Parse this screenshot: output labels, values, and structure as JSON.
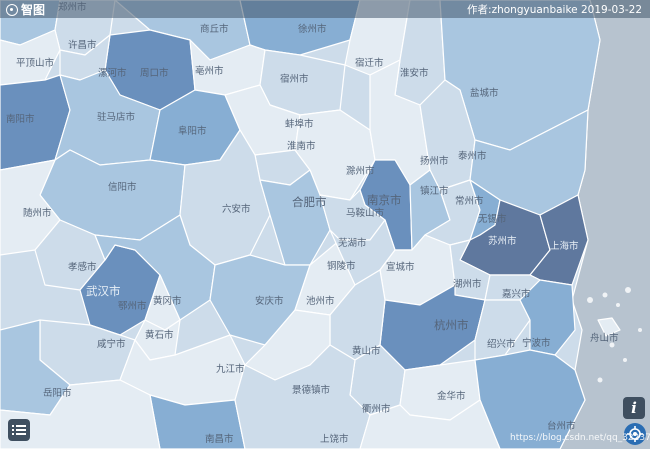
{
  "header": {
    "logo_text": "智图",
    "author_credit": "作者:zhongyuanbaike 2019-03-22"
  },
  "map": {
    "region_colors": {
      "pale": "#e4ecf3",
      "light": "#cddcea",
      "mid": "#a9c6e0",
      "strong": "#87aed3",
      "deep": "#6a90bd",
      "darkest": "#5f789e",
      "sea": "#b7c3cf"
    },
    "cities": [
      {
        "name": "郑州市",
        "style": "normal"
      },
      {
        "name": "许昌市",
        "style": "normal"
      },
      {
        "name": "商丘市",
        "style": "normal"
      },
      {
        "name": "徐州市",
        "style": "normal"
      },
      {
        "name": "平顶山市",
        "style": "normal"
      },
      {
        "name": "周口市",
        "style": "normal"
      },
      {
        "name": "漯河市",
        "style": "normal"
      },
      {
        "name": "亳州市",
        "style": "normal"
      },
      {
        "name": "宿州市",
        "style": "normal"
      },
      {
        "name": "宿迁市",
        "style": "normal"
      },
      {
        "name": "淮安市",
        "style": "normal"
      },
      {
        "name": "盐城市",
        "style": "normal"
      },
      {
        "name": "南阳市",
        "style": "normal"
      },
      {
        "name": "驻马店市",
        "style": "normal"
      },
      {
        "name": "阜阳市",
        "style": "normal"
      },
      {
        "name": "蚌埠市",
        "style": "normal"
      },
      {
        "name": "淮南市",
        "style": "normal"
      },
      {
        "name": "滁州市",
        "style": "normal"
      },
      {
        "name": "扬州市",
        "style": "normal"
      },
      {
        "name": "泰州市",
        "style": "normal"
      },
      {
        "name": "南京市",
        "style": "big"
      },
      {
        "name": "信阳市",
        "style": "normal"
      },
      {
        "name": "随州市",
        "style": "normal"
      },
      {
        "name": "六安市",
        "style": "normal"
      },
      {
        "name": "合肥市",
        "style": "big"
      },
      {
        "name": "马鞍山市",
        "style": "normal"
      },
      {
        "name": "镇江市",
        "style": "normal"
      },
      {
        "name": "常州市",
        "style": "normal"
      },
      {
        "name": "无锡市",
        "style": "normal"
      },
      {
        "name": "苏州市",
        "style": "dark"
      },
      {
        "name": "上海市",
        "style": "dark"
      },
      {
        "name": "芜湖市",
        "style": "normal"
      },
      {
        "name": "铜陵市",
        "style": "normal"
      },
      {
        "name": "宣城市",
        "style": "normal"
      },
      {
        "name": "湖州市",
        "style": "normal"
      },
      {
        "name": "嘉兴市",
        "style": "normal"
      },
      {
        "name": "孝感市",
        "style": "normal"
      },
      {
        "name": "武汉市",
        "style": "bigdark"
      },
      {
        "name": "黄冈市",
        "style": "normal"
      },
      {
        "name": "鄂州市",
        "style": "normal"
      },
      {
        "name": "黄石市",
        "style": "normal"
      },
      {
        "name": "安庆市",
        "style": "normal"
      },
      {
        "name": "池州市",
        "style": "normal"
      },
      {
        "name": "杭州市",
        "style": "big"
      },
      {
        "name": "绍兴市",
        "style": "normal"
      },
      {
        "name": "宁波市",
        "style": "normal"
      },
      {
        "name": "咸宁市",
        "style": "normal"
      },
      {
        "name": "黄山市",
        "style": "normal"
      },
      {
        "name": "舟山市",
        "style": "normal"
      },
      {
        "name": "岳阳市",
        "style": "normal"
      },
      {
        "name": "九江市",
        "style": "normal"
      },
      {
        "name": "景德镇市",
        "style": "normal"
      },
      {
        "name": "衢州市",
        "style": "normal"
      },
      {
        "name": "金华市",
        "style": "normal"
      },
      {
        "name": "台州市",
        "style": "normal"
      },
      {
        "name": "南昌市",
        "style": "normal"
      },
      {
        "name": "上饶市",
        "style": "normal"
      }
    ]
  },
  "controls": {
    "list_button": "list-icon",
    "info_button_label": "i",
    "locate_button": "locate-icon"
  },
  "watermark_text": "https://blog.csdn.net/qq_32237635"
}
